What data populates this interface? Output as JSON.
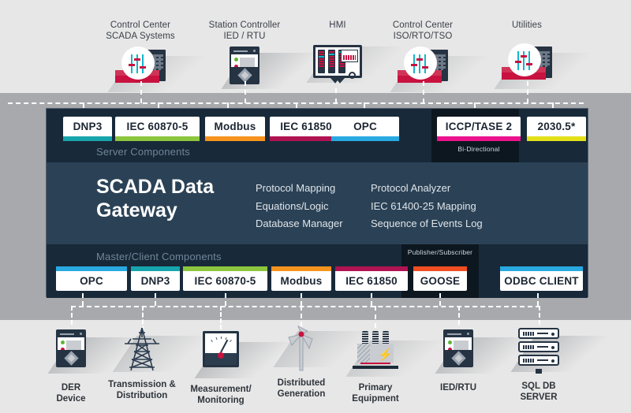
{
  "diagram": {
    "title": "SCADA Data Gateway",
    "server_section_label": "Server Components",
    "master_section_label": "Master/Client Components"
  },
  "top_devices": [
    {
      "name": "scada-systems",
      "line1": "Control Center",
      "line2": "SCADA Systems",
      "icon": "scada-rack-icon"
    },
    {
      "name": "station-controller",
      "line1": "Station Controller",
      "line2": "IED / RTU",
      "icon": "ied-device-icon"
    },
    {
      "name": "hmi",
      "line1": "HMI",
      "line2": "",
      "icon": "hmi-monitor-icon"
    },
    {
      "name": "control-center-iso",
      "line1": "Control Center",
      "line2": "ISO/RTO/TSO",
      "icon": "scada-rack-icon"
    },
    {
      "name": "utilities",
      "line1": "Utilities",
      "line2": "",
      "icon": "scada-rack-icon"
    }
  ],
  "server_components": [
    {
      "label": "DNP3",
      "color": "#17a5ad",
      "sub": ""
    },
    {
      "label": "IEC 60870-5",
      "color": "#8cc63e",
      "sub": ""
    },
    {
      "label": "Modbus",
      "color": "#f7941e",
      "sub": ""
    },
    {
      "label": "IEC 61850",
      "color": "#b01352",
      "sub": ""
    },
    {
      "label": "OPC",
      "color": "#29a9e1",
      "sub": ""
    },
    {
      "label": "ICCP/TASE  2",
      "color": "#ec128d",
      "sub": "Bi-Directional"
    },
    {
      "label": "2030.5*",
      "color": "#e3e018",
      "sub": ""
    }
  ],
  "core_features": {
    "column_1": [
      "Protocol Mapping",
      "Equations/Logic",
      "Database Manager"
    ],
    "column_2": [
      "Protocol Analyzer",
      "IEC 61400-25 Mapping",
      "Sequence of Events Log"
    ]
  },
  "master_components": [
    {
      "label": "OPC",
      "color": "#29a9e1",
      "sub": ""
    },
    {
      "label": "DNP3",
      "color": "#17a5ad",
      "sub": ""
    },
    {
      "label": "IEC 60870-5",
      "color": "#8cc63e",
      "sub": ""
    },
    {
      "label": "Modbus",
      "color": "#f7941e",
      "sub": ""
    },
    {
      "label": "IEC 61850",
      "color": "#b01352",
      "sub": ""
    },
    {
      "label": "GOOSE",
      "color": "#f04e23",
      "sub": "Publisher/Subscriber"
    },
    {
      "label": "ODBC CLIENT",
      "color": "#29a9e1",
      "sub": ""
    }
  ],
  "bottom_devices": [
    {
      "name": "der-device",
      "line1": "DER",
      "line2": "Device",
      "icon": "ied-device-icon"
    },
    {
      "name": "transmission-distribution",
      "line1": "Transmission &",
      "line2": "Distribution",
      "icon": "pylon-icon"
    },
    {
      "name": "measurement-monitoring",
      "line1": "Measurement/",
      "line2": "Monitoring",
      "icon": "meter-icon"
    },
    {
      "name": "distributed-generation",
      "line1": "Distributed",
      "line2": "Generation",
      "icon": "wind-turbine-icon"
    },
    {
      "name": "primary-equipment",
      "line1": "Primary",
      "line2": "Equipment",
      "icon": "transformer-icon"
    },
    {
      "name": "ied-rtu",
      "line1": "IED/RTU",
      "line2": "",
      "icon": "ied-device-icon"
    },
    {
      "name": "sql-db-server",
      "line1": "SQL DB",
      "line2": "SERVER",
      "icon": "server-stack-icon"
    }
  ],
  "colors": {
    "band_light": "#e7e7e7",
    "band_mid": "#a7a9ac",
    "panel_dark": "#18293a",
    "panel_core": "#2b4256",
    "panel_block": "#0d1720",
    "connector": "#ffffff"
  }
}
